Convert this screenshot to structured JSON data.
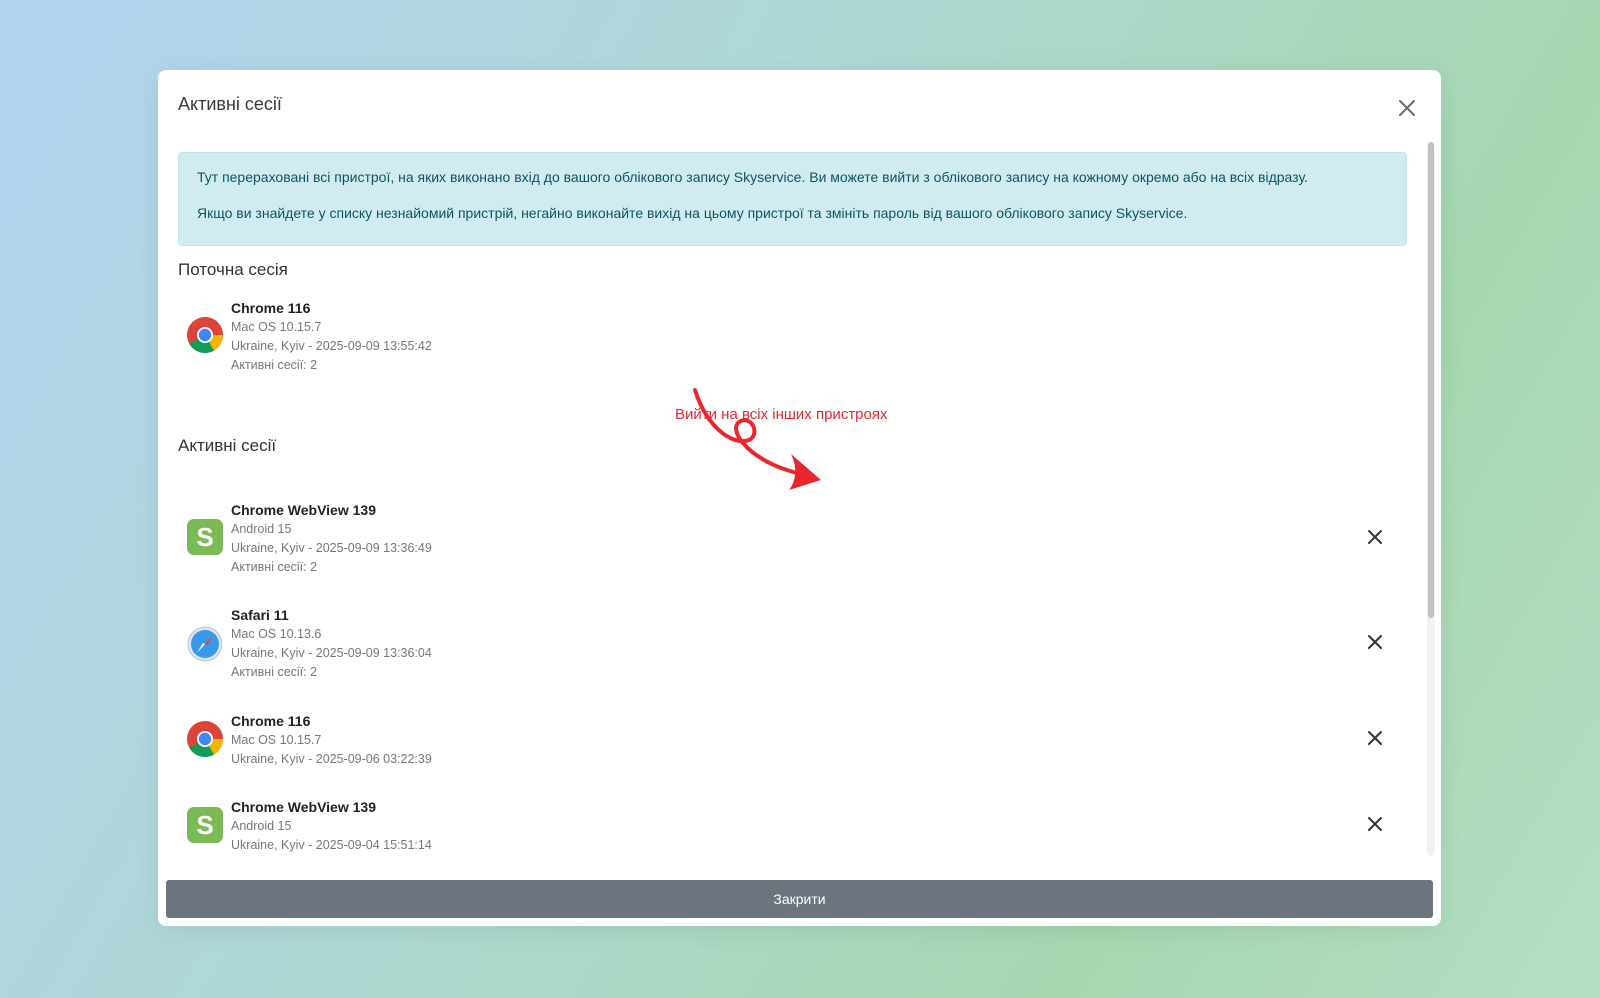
{
  "modal": {
    "title": "Активні сесії",
    "info_line1": "Тут перераховані всі пристрої, на яких виконано вхід до вашого облікового запису Skyservice. Ви можете вийти з облікового запису на кожному окремо або на всіх відразу.",
    "info_line2": "Якщо ви знайдете у списку незнайомий пристрій, негайно виконайте вихід на цьому пристрої та змініть пароль від вашого облікового запису Skyservice.",
    "current_title": "Поточна сесія",
    "active_title": "Активні сесії",
    "close_button": "Закрити"
  },
  "annotation": {
    "text": "Вийти на всіх інших пристроях",
    "color": "#e8262e"
  },
  "current": {
    "icon": "chrome-icon",
    "name": "Chrome 116",
    "os": "Mac OS 10.15.7",
    "location": "Ukraine, Kyiv - 2025-09-09 13:55:42",
    "count": "Активні сесії: 2"
  },
  "sessions": [
    {
      "icon": "skyservice-icon",
      "name": "Chrome WebView 139",
      "os": "Android 15",
      "location": "Ukraine, Kyiv - 2025-09-09 13:36:49",
      "count": "Активні сесії: 2"
    },
    {
      "icon": "safari-icon",
      "name": "Safari 11",
      "os": "Mac OS 10.13.6",
      "location": "Ukraine, Kyiv - 2025-09-09 13:36:04",
      "count": "Активні сесії: 2"
    },
    {
      "icon": "chrome-icon",
      "name": "Chrome 116",
      "os": "Mac OS 10.15.7",
      "location": "Ukraine, Kyiv - 2025-09-06 03:22:39"
    },
    {
      "icon": "skyservice-icon",
      "name": "Chrome WebView 139",
      "os": "Android 15",
      "location": "Ukraine, Kyiv - 2025-09-04 15:51:14"
    }
  ]
}
